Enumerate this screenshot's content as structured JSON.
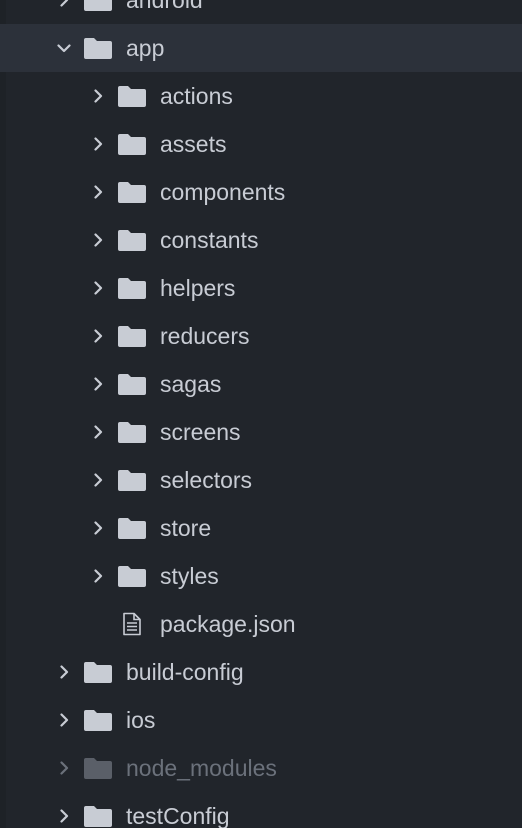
{
  "tree": {
    "items": [
      {
        "label": "android",
        "type": "folder",
        "depth": 0,
        "expanded": false,
        "selected": false,
        "dim": false
      },
      {
        "label": "app",
        "type": "folder",
        "depth": 0,
        "expanded": true,
        "selected": true,
        "dim": false
      },
      {
        "label": "actions",
        "type": "folder",
        "depth": 1,
        "expanded": false,
        "selected": false,
        "dim": false
      },
      {
        "label": "assets",
        "type": "folder",
        "depth": 1,
        "expanded": false,
        "selected": false,
        "dim": false
      },
      {
        "label": "components",
        "type": "folder",
        "depth": 1,
        "expanded": false,
        "selected": false,
        "dim": false
      },
      {
        "label": "constants",
        "type": "folder",
        "depth": 1,
        "expanded": false,
        "selected": false,
        "dim": false
      },
      {
        "label": "helpers",
        "type": "folder",
        "depth": 1,
        "expanded": false,
        "selected": false,
        "dim": false
      },
      {
        "label": "reducers",
        "type": "folder",
        "depth": 1,
        "expanded": false,
        "selected": false,
        "dim": false
      },
      {
        "label": "sagas",
        "type": "folder",
        "depth": 1,
        "expanded": false,
        "selected": false,
        "dim": false
      },
      {
        "label": "screens",
        "type": "folder",
        "depth": 1,
        "expanded": false,
        "selected": false,
        "dim": false
      },
      {
        "label": "selectors",
        "type": "folder",
        "depth": 1,
        "expanded": false,
        "selected": false,
        "dim": false
      },
      {
        "label": "store",
        "type": "folder",
        "depth": 1,
        "expanded": false,
        "selected": false,
        "dim": false
      },
      {
        "label": "styles",
        "type": "folder",
        "depth": 1,
        "expanded": false,
        "selected": false,
        "dim": false
      },
      {
        "label": "package.json",
        "type": "file",
        "depth": 1,
        "expanded": false,
        "selected": false,
        "dim": false
      },
      {
        "label": "build-config",
        "type": "folder",
        "depth": 0,
        "expanded": false,
        "selected": false,
        "dim": false
      },
      {
        "label": "ios",
        "type": "folder",
        "depth": 0,
        "expanded": false,
        "selected": false,
        "dim": false
      },
      {
        "label": "node_modules",
        "type": "folder",
        "depth": 0,
        "expanded": false,
        "selected": false,
        "dim": true
      },
      {
        "label": "testConfig",
        "type": "folder",
        "depth": 0,
        "expanded": false,
        "selected": false,
        "dim": false
      }
    ]
  },
  "icons": {
    "folder": "folder-icon",
    "file": "file-text-icon",
    "collapsed": "chevron-right-icon",
    "expanded": "chevron-down-icon"
  },
  "colors": {
    "background": "#21252b",
    "selected_row": "#2c313a",
    "text": "#c8ccd4",
    "icon": "#c8ccd4",
    "dim_text": "#6b717b"
  }
}
